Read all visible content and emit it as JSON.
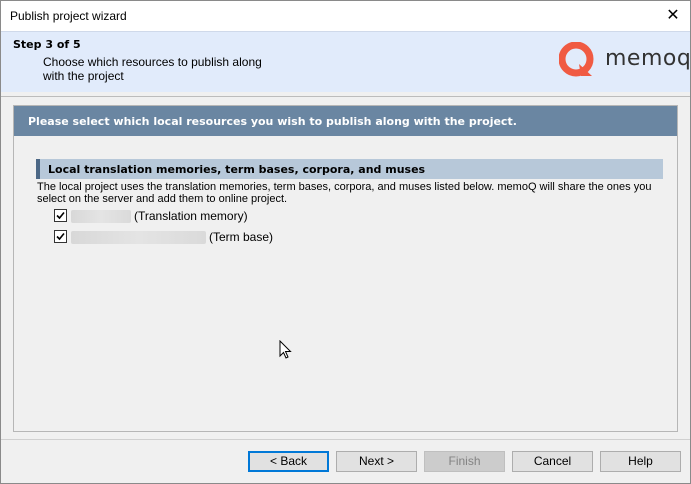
{
  "window": {
    "title": "Publish project wizard",
    "close_glyph": "✕"
  },
  "header": {
    "step": "Step 3 of 5",
    "description": "Choose which resources to publish along with the project",
    "logo_text": "memoq"
  },
  "banner": {
    "text": "Please select which local resources you wish to publish along with the project."
  },
  "section": {
    "title": "Local translation memories, term bases, corpora, and muses",
    "description": "The local project uses the translation memories, term bases, corpora, and muses listed below. memoQ will share the ones you select on the server and add them to online project."
  },
  "resources": [
    {
      "type_label": "(Translation memory)",
      "checked": true
    },
    {
      "type_label": "(Term base)",
      "checked": true
    }
  ],
  "buttons": {
    "back": "< Back",
    "next": "Next >",
    "finish": "Finish",
    "cancel": "Cancel",
    "help": "Help"
  },
  "colors": {
    "header_bg": "#e1ebfb",
    "banner_bg": "#6a86a2",
    "section_bg": "#b7c8d9",
    "logo_accent": "#f05a42"
  },
  "icons": {
    "close": "close-icon",
    "logo": "memoq-logo-icon",
    "checkbox": "checkmark-icon",
    "cursor": "mouse-cursor-icon"
  }
}
